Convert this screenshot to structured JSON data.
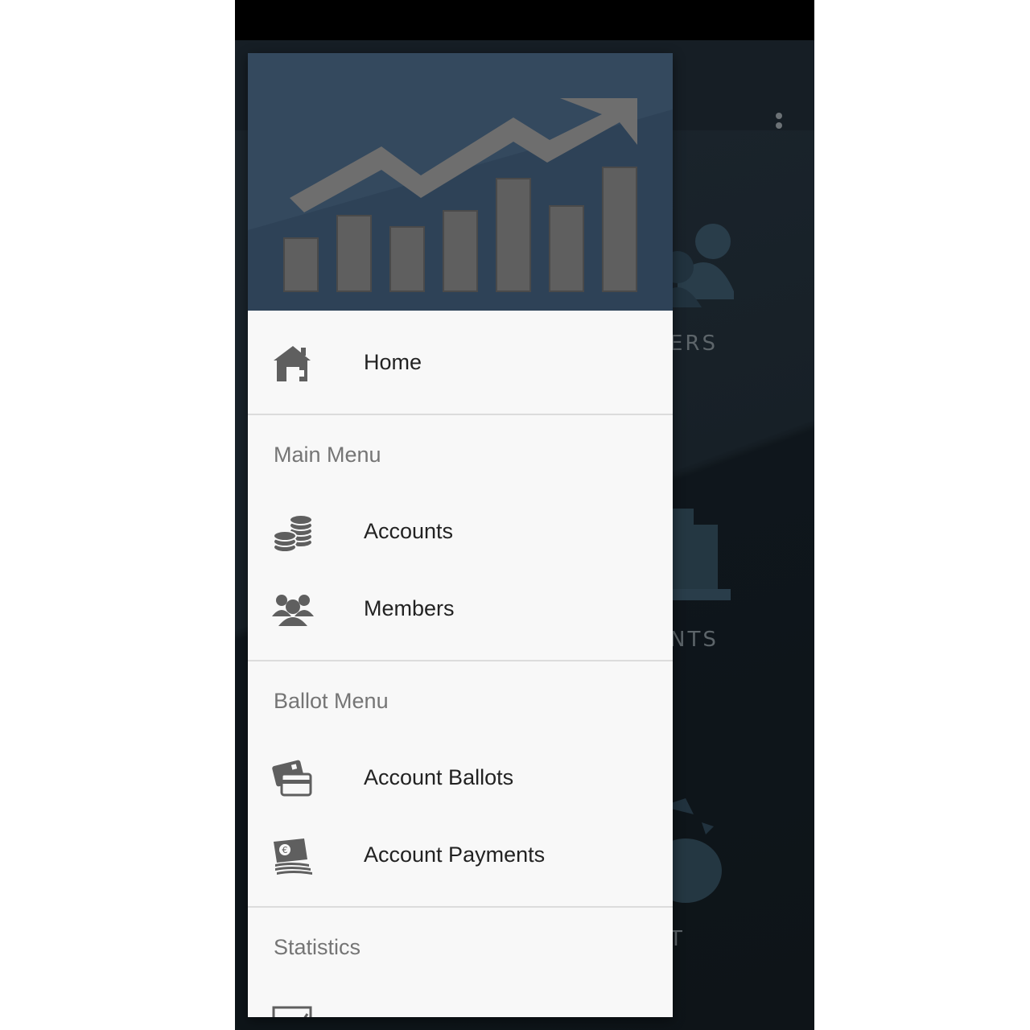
{
  "drawer": {
    "home": {
      "label": "Home",
      "icon": "home-icon"
    },
    "sections": [
      {
        "title": "Main Menu",
        "items": [
          {
            "label": "Accounts",
            "icon": "coins-icon"
          },
          {
            "label": "Members",
            "icon": "group-icon"
          }
        ]
      },
      {
        "title": "Ballot Menu",
        "items": [
          {
            "label": "Account Ballots",
            "icon": "cards-icon"
          },
          {
            "label": "Account Payments",
            "icon": "euro-bills-icon"
          }
        ]
      },
      {
        "title": "Statistics",
        "items": [
          {
            "label": "",
            "icon": "chart-icon"
          }
        ]
      }
    ]
  },
  "background": {
    "labels": [
      "ERS",
      "NTS",
      "T"
    ]
  },
  "colors": {
    "drawer_bg": "#f8f8f8",
    "header_bg": "#34495e",
    "icon_gray": "#5f5f5f",
    "section_title": "#757575"
  }
}
